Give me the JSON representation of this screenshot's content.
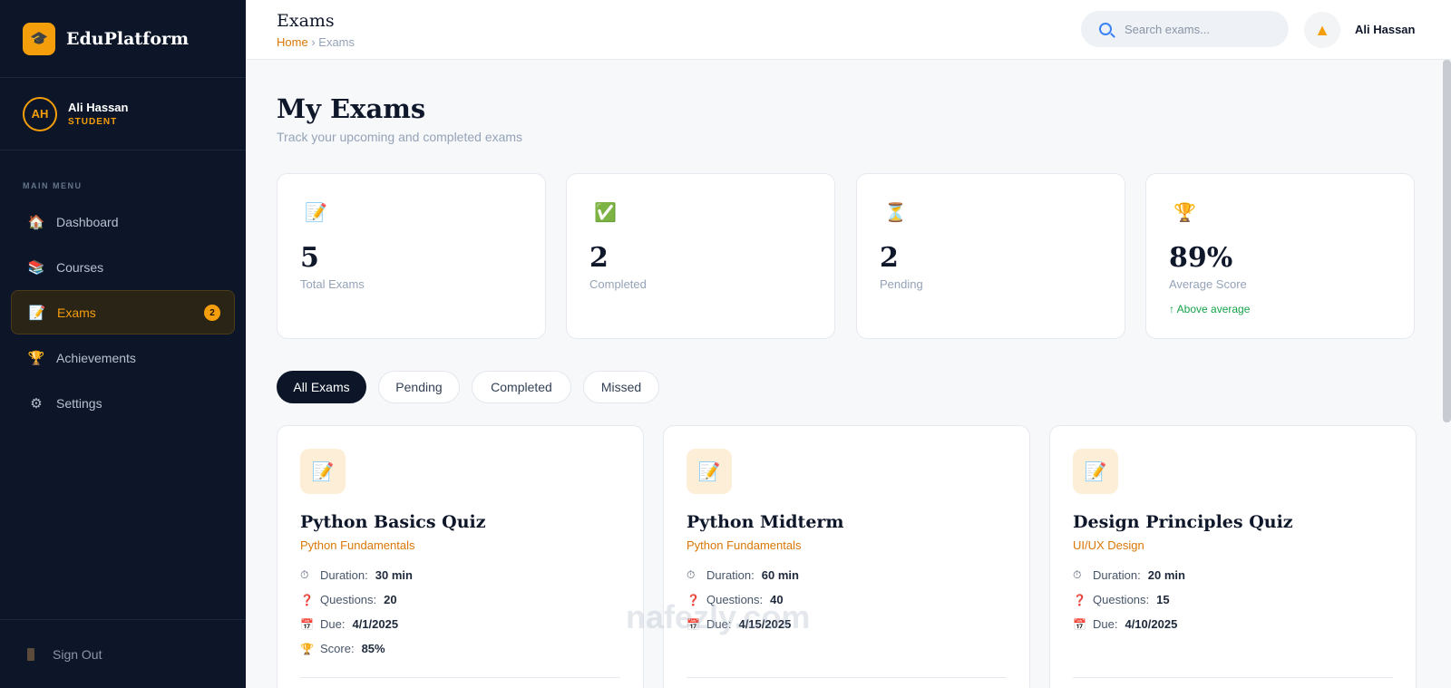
{
  "brand": {
    "name": "EduPlatform",
    "logo_icon": "graduation-cap-icon"
  },
  "user": {
    "initials": "AH",
    "name": "Ali Hassan",
    "role": "STUDENT"
  },
  "sidebar": {
    "menu_label": "MAIN MENU",
    "items": [
      {
        "label": "Dashboard",
        "icon": "house-icon"
      },
      {
        "label": "Courses",
        "icon": "books-icon"
      },
      {
        "label": "Exams",
        "icon": "document-icon",
        "badge": "2"
      },
      {
        "label": "Achievements",
        "icon": "trophy-icon"
      },
      {
        "label": "Settings",
        "icon": "gear-icon"
      }
    ],
    "sign_out": "Sign Out"
  },
  "header": {
    "title": "Exams",
    "breadcrumb_home": "Home",
    "breadcrumb_sep": "›",
    "breadcrumb_current": "Exams",
    "search_placeholder": "Search exams...",
    "user_name": "Ali Hassan"
  },
  "main": {
    "title": "My Exams",
    "subtitle": "Track your upcoming and completed exams"
  },
  "stats": [
    {
      "icon": "memo-icon",
      "value": "5",
      "label": "Total Exams"
    },
    {
      "icon": "check-icon",
      "value": "2",
      "label": "Completed"
    },
    {
      "icon": "hourglass-icon",
      "value": "2",
      "label": "Pending"
    },
    {
      "icon": "trophy-icon",
      "value": "89%",
      "label": "Average Score",
      "trend": "↑ Above average"
    }
  ],
  "filters": [
    "All Exams",
    "Pending",
    "Completed",
    "Missed"
  ],
  "exams": [
    {
      "title": "Python Basics Quiz",
      "course": "Python Fundamentals",
      "duration_label": "Duration:",
      "duration": "30 min",
      "questions_label": "Questions:",
      "questions": "20",
      "due_label": "Due:",
      "due": "4/1/2025",
      "score_label": "Score:",
      "score": "85%"
    },
    {
      "title": "Python Midterm",
      "course": "Python Fundamentals",
      "duration_label": "Duration:",
      "duration": "60 min",
      "questions_label": "Questions:",
      "questions": "40",
      "due_label": "Due:",
      "due": "4/15/2025"
    },
    {
      "title": "Design Principles Quiz",
      "course": "UI/UX Design",
      "duration_label": "Duration:",
      "duration": "20 min",
      "questions_label": "Questions:",
      "questions": "15",
      "due_label": "Due:",
      "due": "4/10/2025"
    }
  ],
  "watermark": "nafezly.com",
  "colors": {
    "accent": "#f59e0b",
    "sidebar_bg": "#0d1628",
    "success": "#16a34a"
  }
}
